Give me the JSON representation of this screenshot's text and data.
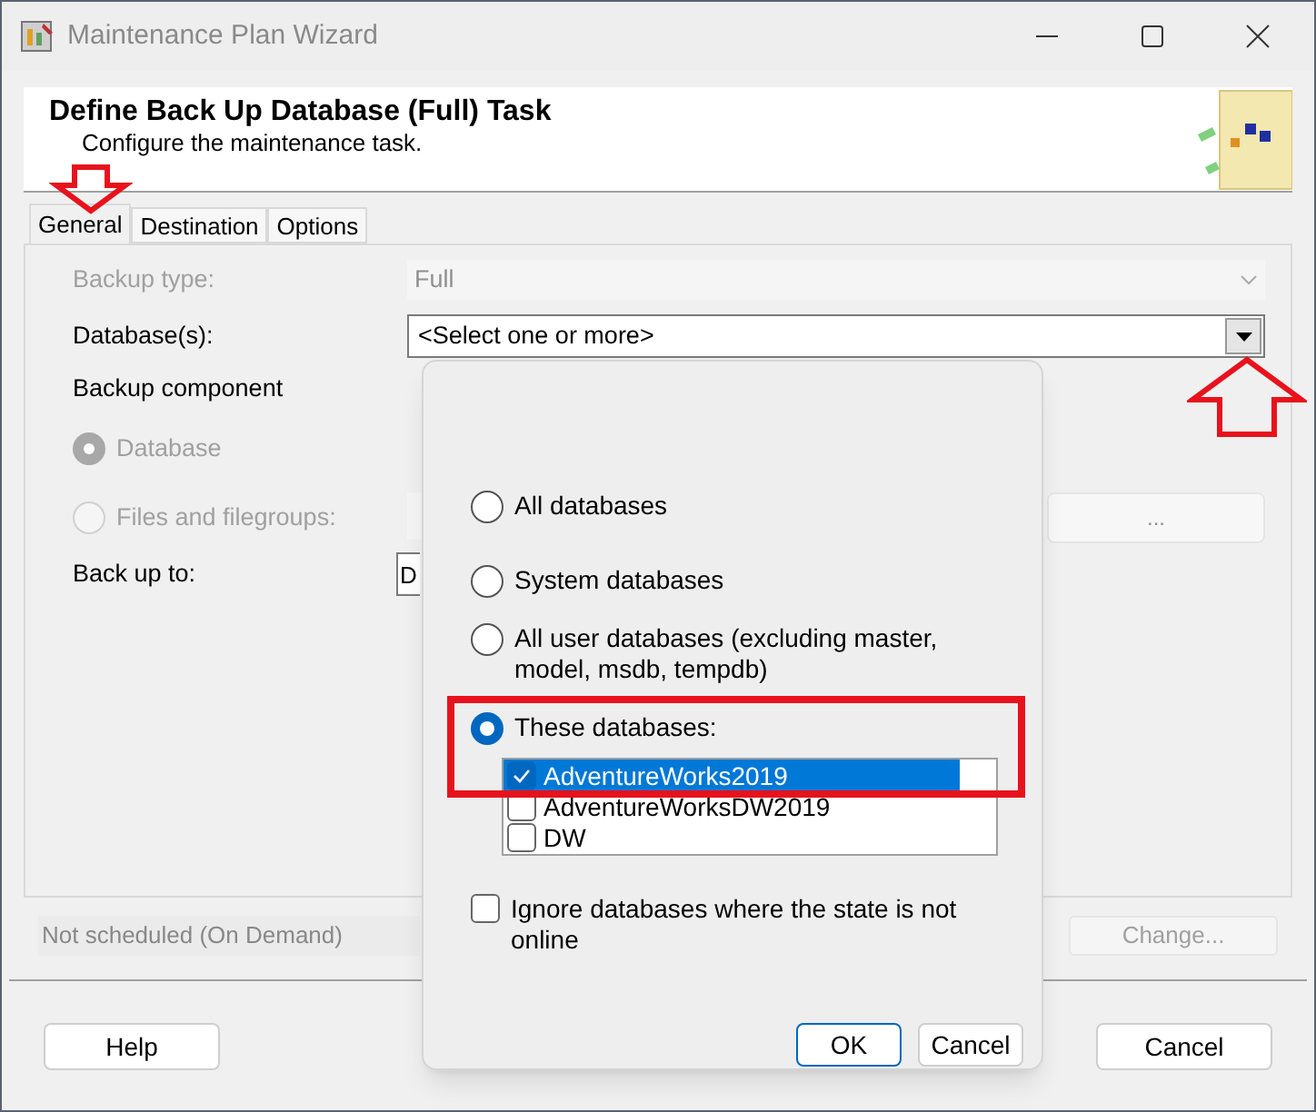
{
  "window": {
    "title": "Maintenance Plan Wizard"
  },
  "header": {
    "title": "Define Back Up Database (Full) Task",
    "subtitle": "Configure the maintenance task."
  },
  "tabs": [
    {
      "label": "General",
      "selected": true
    },
    {
      "label": "Destination",
      "selected": false
    },
    {
      "label": "Options",
      "selected": false
    }
  ],
  "form": {
    "backup_type": {
      "label": "Backup type:",
      "value": "Full",
      "disabled": true
    },
    "databases": {
      "label": "Database(s):",
      "value": "<Select one or more>"
    },
    "backup_component": {
      "label": "Backup component",
      "options": [
        {
          "label": "Database",
          "selected": true,
          "disabled": true
        },
        {
          "label": "Files and filegroups:",
          "selected": false,
          "disabled": true
        }
      ],
      "browse_button": "..."
    },
    "back_up_to": {
      "label": "Back up to:",
      "value": "D"
    }
  },
  "schedule": {
    "text": "Not scheduled (On Demand)",
    "button": "Change..."
  },
  "buttons": [
    {
      "label": "Help"
    },
    {
      "label": "Cancel"
    }
  ],
  "popup": {
    "options": [
      {
        "label": "All databases",
        "selected": false
      },
      {
        "label": "System databases",
        "selected": false
      },
      {
        "label": "All user databases  (excluding master, model, msdb, tempdb)",
        "selected": false
      },
      {
        "label": "These databases:",
        "selected": true
      }
    ],
    "databases": [
      {
        "name": "AdventureWorks2019",
        "checked": true,
        "selected": true
      },
      {
        "name": "AdventureWorksDW2019",
        "checked": false,
        "selected": false
      },
      {
        "name": "DW",
        "checked": false,
        "selected": false
      }
    ],
    "ignore_offline": {
      "label": "Ignore databases where the state is not online",
      "checked": false
    },
    "buttons": [
      {
        "label": "OK",
        "default": true
      },
      {
        "label": "Cancel",
        "default": false
      }
    ]
  }
}
